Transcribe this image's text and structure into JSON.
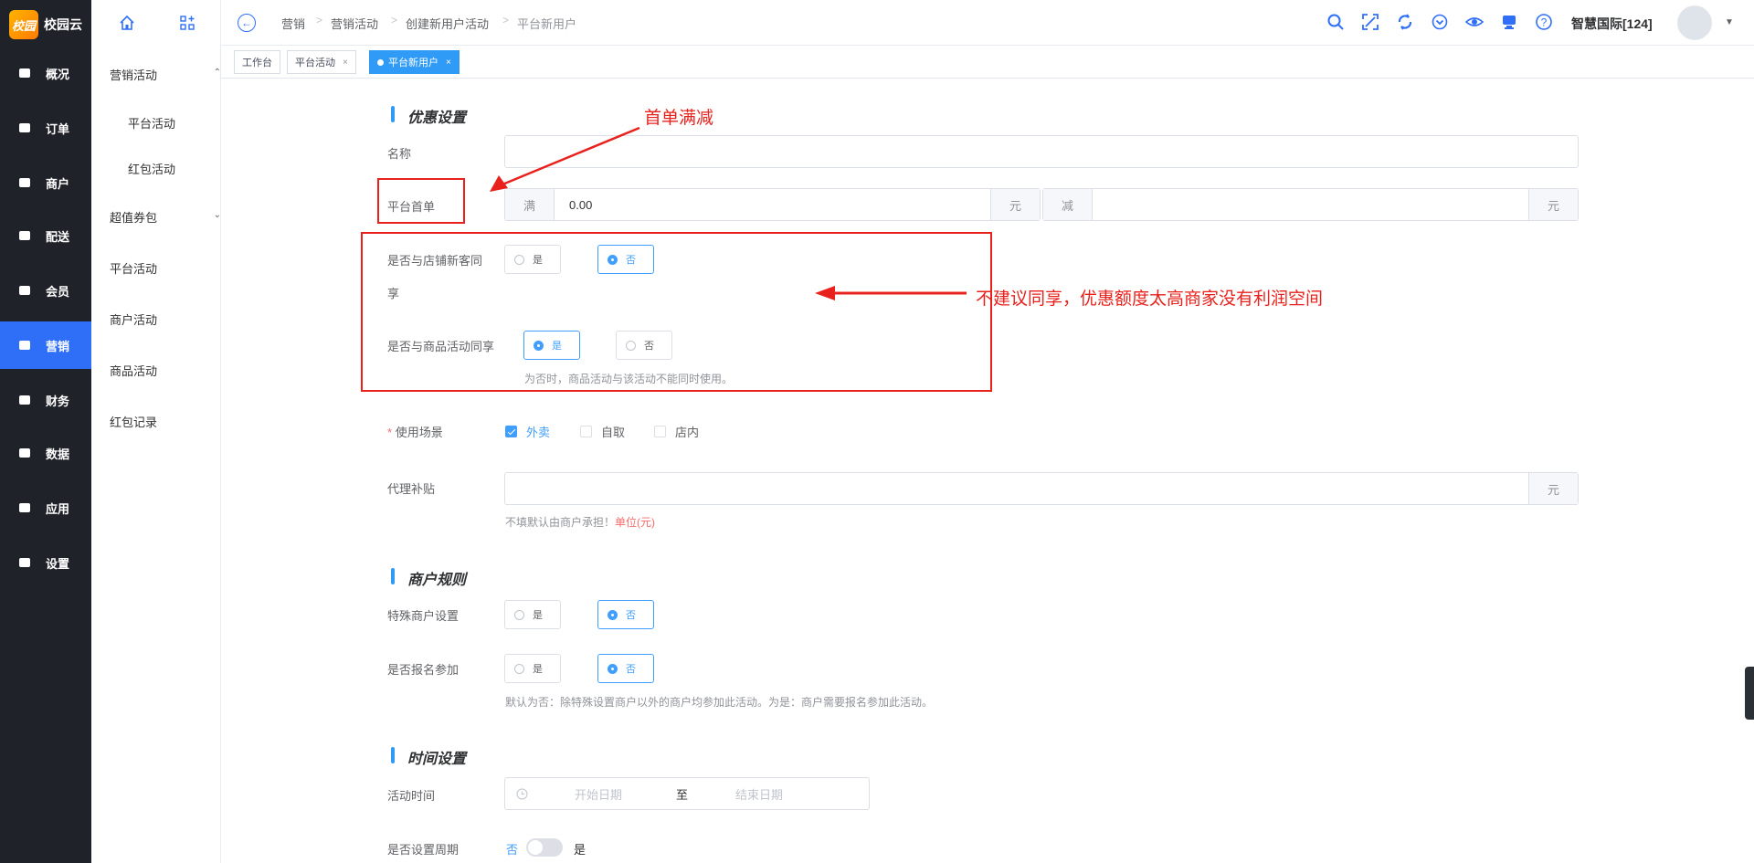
{
  "app": {
    "logo_mark": "校园",
    "logo_text": "校园云"
  },
  "nav": {
    "items": [
      {
        "label": "概况",
        "icon": "dashboard-icon"
      },
      {
        "label": "订单",
        "icon": "order-icon"
      },
      {
        "label": "商户",
        "icon": "store-icon"
      },
      {
        "label": "配送",
        "icon": "delivery-icon"
      },
      {
        "label": "会员",
        "icon": "diamond-icon"
      },
      {
        "label": "营销",
        "icon": "ticket-icon",
        "active": true
      },
      {
        "label": "财务",
        "icon": "money-bag-icon"
      },
      {
        "label": "数据",
        "icon": "chart-monitor-icon"
      },
      {
        "label": "应用",
        "icon": "cube-icon"
      },
      {
        "label": "设置",
        "icon": "gear-icon"
      }
    ]
  },
  "subnav": {
    "items": [
      {
        "label": "营销活动",
        "expanded": true
      },
      {
        "label": "平台活动",
        "child": true
      },
      {
        "label": "红包活动",
        "child": true
      },
      {
        "label": "超值券包",
        "expanded": false
      },
      {
        "label": "平台活动"
      },
      {
        "label": "商户活动"
      },
      {
        "label": "商品活动"
      },
      {
        "label": "红包记录"
      }
    ]
  },
  "header": {
    "breadcrumbs": [
      "营销",
      "营销活动",
      "创建新用户活动",
      "平台新用户"
    ],
    "user_name": "智慧国际[124]"
  },
  "tabs": [
    {
      "label": "工作台"
    },
    {
      "label": "平台活动",
      "closable": true
    },
    {
      "label": "平台新用户",
      "closable": true,
      "active": true
    }
  ],
  "form": {
    "discount_section_title": "优惠设置",
    "name_label": "名称",
    "name_value": "",
    "first_order_label": "平台首单",
    "full_addon": "满",
    "full_value": "0.00",
    "yuan_unit": "元",
    "minus_addon": "减",
    "minus_value": "",
    "share_store_label_line1": "是否与店铺新客同",
    "share_store_label_line2": "享",
    "share_store_value": "否",
    "share_goods_label": "是否与商品活动同享",
    "share_goods_value": "是",
    "share_goods_hint": "为否时，商品活动与该活动不能同时使用。",
    "yes": "是",
    "no": "否",
    "scene_required_mark": "*",
    "scene_label": "使用场景",
    "scenes": [
      {
        "label": "外卖",
        "checked": true
      },
      {
        "label": "自取",
        "checked": false
      },
      {
        "label": "店内",
        "checked": false
      }
    ],
    "agent_subsidy_label": "代理补贴",
    "agent_subsidy_value": "",
    "agent_subsidy_hint": "不填默认由商户承担！",
    "agent_subsidy_hint_red": "单位(元)",
    "merchant_section_title": "商户规则",
    "special_merchant_label": "特殊商户设置",
    "special_merchant_value": "否",
    "signup_label": "是否报名参加",
    "signup_value": "否",
    "signup_hint": "默认为否：除特殊设置商户以外的商户均参加此活动。为是：商户需要报名参加此活动。",
    "time_section_title": "时间设置",
    "activity_time_label": "活动时间",
    "start_placeholder": "开始日期",
    "range_sep": "至",
    "end_placeholder": "结束日期",
    "cycle_label": "是否设置周期",
    "cycle_off": "否",
    "cycle_on": "是",
    "cycle_value": false
  },
  "annotations": {
    "first_order_note": "首单满减",
    "share_note": "不建议同享，优惠额度太高商家没有利润空间",
    "color": "#e8211c"
  },
  "colors": {
    "accent": "#2f6ff7",
    "tab_active": "#2f9bf7",
    "nav_bg": "#1f2229",
    "radio_active": "#409eff"
  }
}
